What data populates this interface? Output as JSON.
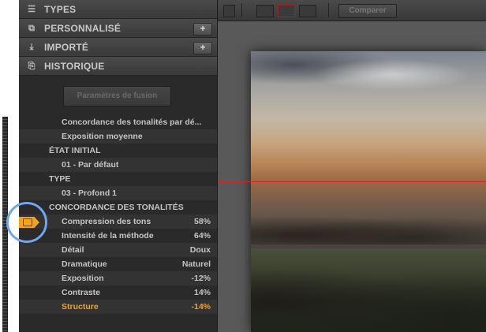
{
  "panel": {
    "sections": [
      {
        "label": "TYPES",
        "icon": "list-icon"
      },
      {
        "label": "PERSONNALISÉ",
        "icon": "preset-icon",
        "plus": "+"
      },
      {
        "label": "IMPORTÉ",
        "icon": "import-icon",
        "plus": "+"
      },
      {
        "label": "HISTORIQUE",
        "icon": "history-icon"
      }
    ],
    "fusion_button": "Paramètres de fusion",
    "history": [
      {
        "text": "Concordance des tonalités par dé...",
        "value": ""
      },
      {
        "text": "Exposition moyenne",
        "value": ""
      },
      {
        "text": "ÉTAT INITIAL",
        "value": ""
      },
      {
        "text": "01 - Par défaut",
        "value": ""
      },
      {
        "text": "TYPE",
        "value": ""
      },
      {
        "text": "03 - Profond 1",
        "value": ""
      },
      {
        "text": "CONCORDANCE DES TONALITÉS",
        "value": ""
      },
      {
        "text": "Compression des tons",
        "value": "58%"
      },
      {
        "text": "Intensité de la méthode",
        "value": "64%"
      },
      {
        "text": "Détail",
        "value": "Doux"
      },
      {
        "text": "Dramatique",
        "value": "Naturel"
      },
      {
        "text": "Exposition",
        "value": "-12%"
      },
      {
        "text": "Contraste",
        "value": "14%"
      },
      {
        "text": "Structure",
        "value": "-14%"
      }
    ]
  },
  "toolbar": {
    "compare_label": "Comparer"
  },
  "colors": {
    "accent": "#f5a21c",
    "highlight": "#6fa6ee",
    "guide": "#d82424"
  }
}
